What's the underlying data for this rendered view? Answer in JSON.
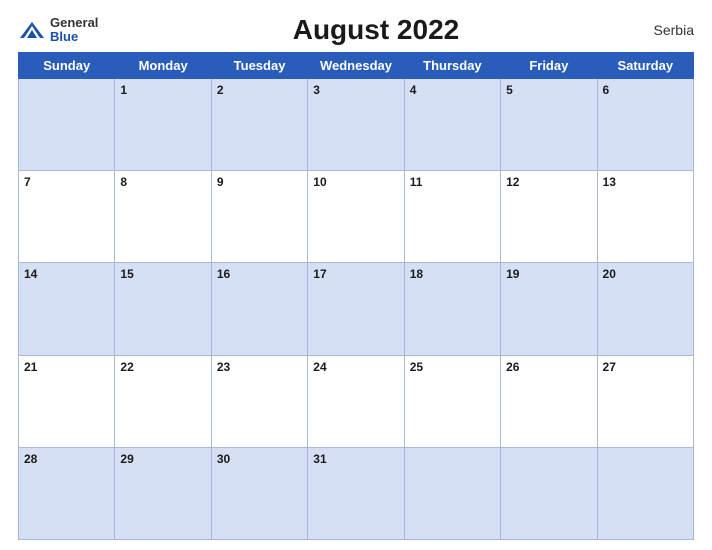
{
  "header": {
    "logo": {
      "general": "General",
      "blue": "Blue",
      "icon_color": "#1a52a8"
    },
    "title": "August 2022",
    "country": "Serbia"
  },
  "calendar": {
    "days_of_week": [
      "Sunday",
      "Monday",
      "Tuesday",
      "Wednesday",
      "Thursday",
      "Friday",
      "Saturday"
    ],
    "weeks": [
      [
        "",
        "1",
        "2",
        "3",
        "4",
        "5",
        "6"
      ],
      [
        "7",
        "8",
        "9",
        "10",
        "11",
        "12",
        "13"
      ],
      [
        "14",
        "15",
        "16",
        "17",
        "18",
        "19",
        "20"
      ],
      [
        "21",
        "22",
        "23",
        "24",
        "25",
        "26",
        "27"
      ],
      [
        "28",
        "29",
        "30",
        "31",
        "",
        "",
        ""
      ]
    ]
  }
}
